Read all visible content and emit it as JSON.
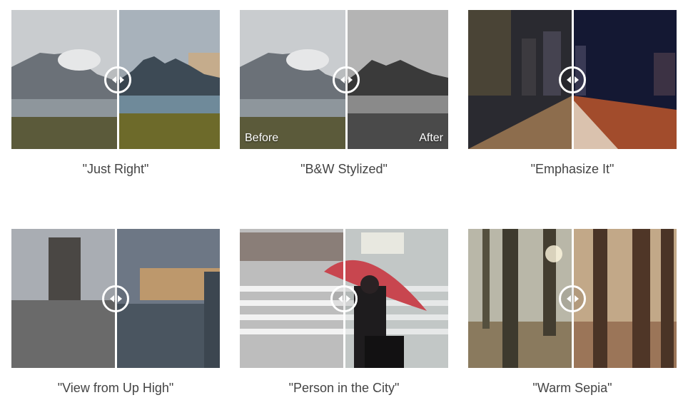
{
  "gallery": {
    "items": [
      {
        "caption": "\"Just Right\"",
        "before_label": "",
        "after_label": ""
      },
      {
        "caption": "\"B&W Stylized\"",
        "before_label": "Before",
        "after_label": "After"
      },
      {
        "caption": "\"Emphasize It\"",
        "before_label": "",
        "after_label": ""
      },
      {
        "caption": "\"View from Up High\"",
        "before_label": "",
        "after_label": ""
      },
      {
        "caption": "\"Person in the City\"",
        "before_label": "",
        "after_label": ""
      },
      {
        "caption": "\"Warm Sepia\"",
        "before_label": "",
        "after_label": ""
      }
    ],
    "handle_icon": "left-right-arrows-icon"
  }
}
